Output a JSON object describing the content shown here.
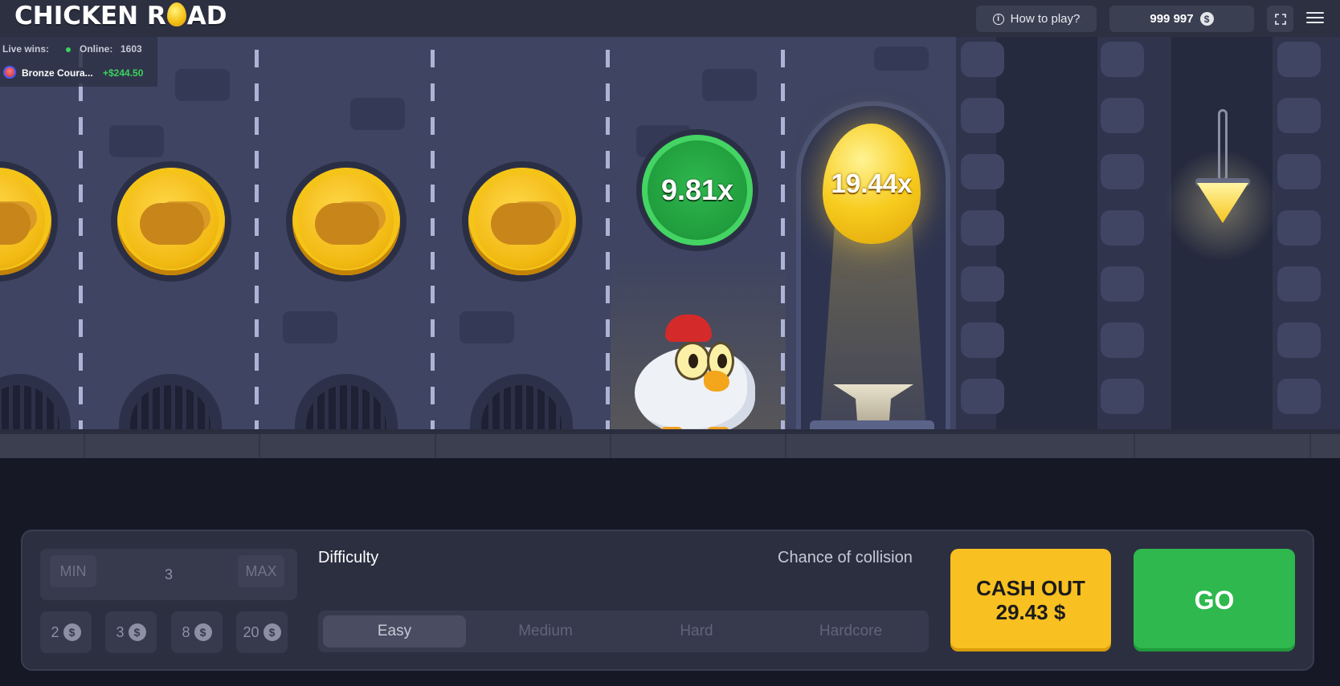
{
  "header": {
    "logo_left": "CHICKEN R",
    "logo_right": "AD",
    "how_to_play": "How to play?",
    "balance": "999 997",
    "currency_symbol": "$"
  },
  "live_wins": {
    "label": "Live wins:",
    "online_label": "Online:",
    "online_count": "1603",
    "latest_player": "Bronze Coura...",
    "latest_amount": "+$244.50"
  },
  "game": {
    "lanes_passed": 4,
    "current_multiplier": "9.81x",
    "next_multiplier": "19.44x"
  },
  "controls": {
    "bet": {
      "min_label": "MIN",
      "max_label": "MAX",
      "value": "3"
    },
    "quick_bets": [
      {
        "value": "2",
        "symbol": "$"
      },
      {
        "value": "3",
        "symbol": "$"
      },
      {
        "value": "8",
        "symbol": "$"
      },
      {
        "value": "20",
        "symbol": "$"
      }
    ],
    "difficulty_label": "Difficulty",
    "chance_label": "Chance of collision",
    "difficulties": [
      "Easy",
      "Medium",
      "Hard",
      "Hardcore"
    ],
    "selected_difficulty": "Easy",
    "cashout_label": "CASH OUT",
    "cashout_amount": "29.43 $",
    "go_label": "GO"
  },
  "colors": {
    "accent_green": "#2fb84e",
    "accent_yellow": "#f9c021",
    "scene_bg": "#3e4461",
    "panel_bg": "#2c2f40"
  },
  "icons": [
    "info-icon",
    "dollar-icon",
    "fullscreen-icon",
    "menu-icon"
  ]
}
